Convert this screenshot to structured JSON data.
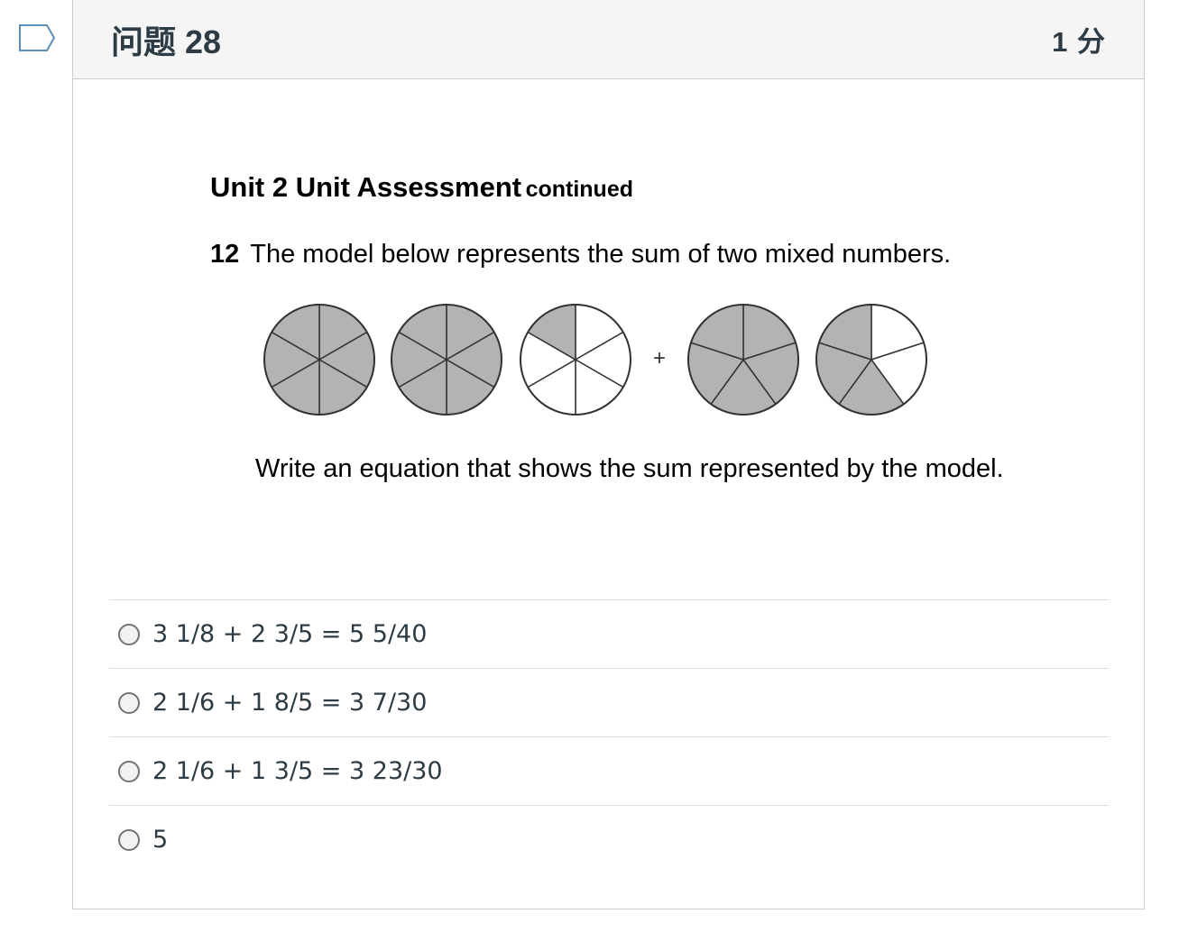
{
  "question": {
    "title": "问题 28",
    "points": "1 分",
    "heading_main": "Unit 2 Unit Assessment",
    "heading_cont": "continued",
    "number": "12",
    "text": "The model below represents the sum of two mixed numbers.",
    "plus_sign": "+",
    "prompt": "Write an equation that shows the sum represented by the model."
  },
  "model": {
    "sixths_circles_shaded": [
      6,
      6,
      1
    ],
    "fifths_circles_shaded": [
      5,
      3
    ],
    "shade_color": "#b3b3b3"
  },
  "answers": [
    {
      "label": "3 1/8 + 2 3/5 = 5 5/40"
    },
    {
      "label": "2 1/6 + 1 8/5 = 3 7/30"
    },
    {
      "label": "2 1/6 + 1 3/5 = 3 23/30"
    },
    {
      "label": "5"
    }
  ],
  "colors": {
    "header_bg": "#f5f5f5",
    "border": "#c7cdd1",
    "text": "#2d3b45",
    "flag": "#5b8db8"
  }
}
